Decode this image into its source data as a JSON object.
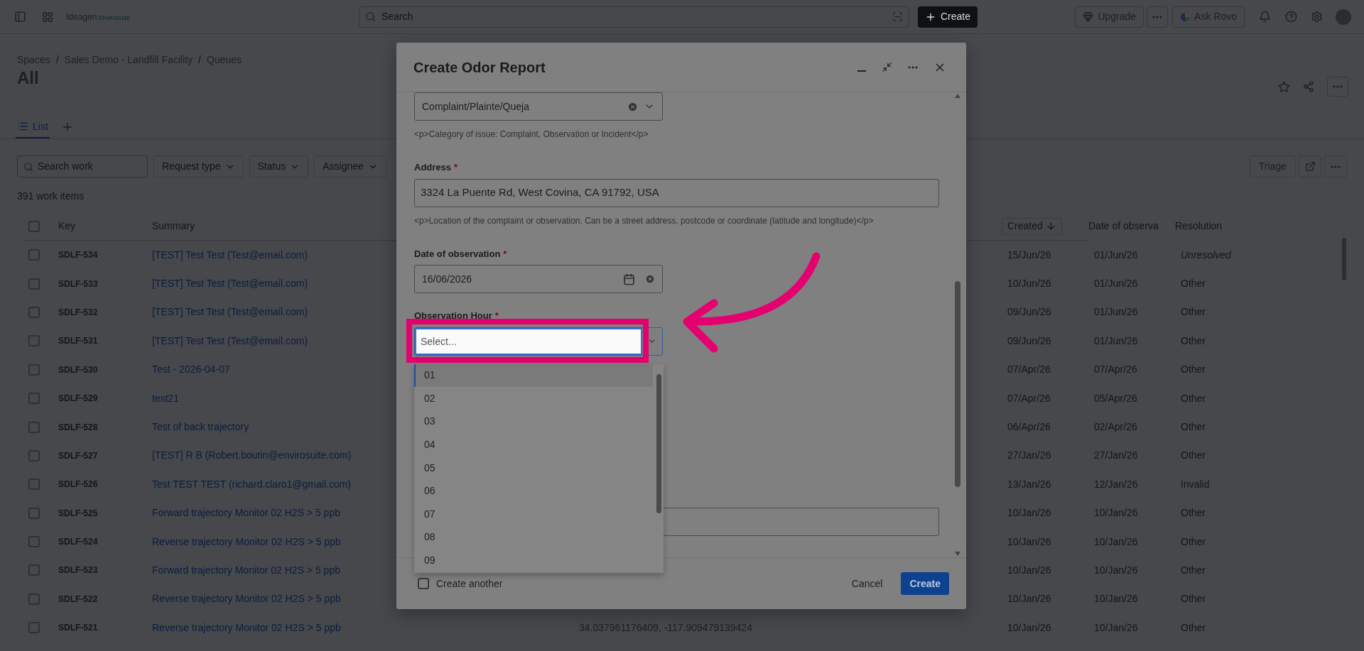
{
  "topbar": {
    "logo": "Ideagen",
    "logo_sub": "Envirosuite",
    "search": {
      "placeholder": "Search"
    },
    "create": "Create",
    "upgrade": "Upgrade",
    "ask": "Ask Rovo"
  },
  "breadcrumbs": [
    "Spaces",
    "Sales Demo - Landfill Facility",
    "Queues"
  ],
  "breadcrumb_separator": "/",
  "title": "All",
  "tabs": [
    {
      "label": "List",
      "selected": true
    }
  ],
  "filters": {
    "search": {
      "placeholder": "Search work"
    },
    "dropdowns": [
      "Request type",
      "Status",
      "Assignee"
    ],
    "triage": "Triage"
  },
  "count": "391 work items",
  "table": {
    "select_all": {
      "checked": false
    },
    "columns": [
      {
        "label": "Key",
        "sorted": false
      },
      {
        "label": "Summary",
        "sorted": false
      },
      {
        "label": "Created",
        "sorted": true
      },
      {
        "label": "Date of observa",
        "sorted": false
      },
      {
        "label": "Resolution",
        "sorted": false
      }
    ],
    "rows": [
      {
        "key": "SDLF-534",
        "summary": "[TEST] Test Test (Test@email.com)",
        "created": "15/Jun/26",
        "date": "01/Jun/26",
        "resolution": "Unresolved",
        "resolved": false,
        "checked": false
      },
      {
        "key": "SDLF-533",
        "summary": "[TEST] Test Test (Test@email.com)",
        "created": "10/Jun/26",
        "date": "01/Jun/26",
        "resolution": "Other",
        "resolved": true,
        "checked": false
      },
      {
        "key": "SDLF-532",
        "summary": "[TEST] Test Test (Test@email.com)",
        "created": "09/Jun/26",
        "date": "01/Jun/26",
        "resolution": "Other",
        "resolved": true,
        "checked": false
      },
      {
        "key": "SDLF-531",
        "summary": "[TEST] Test Test (Test@email.com)",
        "created": "09/Jun/26",
        "date": "01/Jun/26",
        "resolution": "Other",
        "resolved": true,
        "checked": false
      },
      {
        "key": "SDLF-530",
        "summary": "Test - 2026-04-07",
        "created": "07/Apr/26",
        "date": "07/Apr/26",
        "resolution": "Other",
        "resolved": true,
        "checked": false
      },
      {
        "key": "SDLF-529",
        "summary": "test21",
        "created": "07/Apr/26",
        "date": "05/Apr/26",
        "resolution": "Other",
        "resolved": true,
        "checked": false
      },
      {
        "key": "SDLF-528",
        "summary": "Test of back trajectory",
        "created": "06/Apr/26",
        "date": "02/Apr/26",
        "resolution": "Other",
        "resolved": true,
        "checked": false
      },
      {
        "key": "SDLF-527",
        "summary": "[TEST] R B (Robert.boutin@envirosuite.com)",
        "created": "27/Jan/26",
        "date": "27/Jan/26",
        "resolution": "Other",
        "resolved": true,
        "checked": false
      },
      {
        "key": "SDLF-526",
        "summary": "Test TEST TEST (richard.claro1@gmail.com)",
        "created": "13/Jan/26",
        "date": "12/Jan/26",
        "resolution": "Invalid",
        "resolved": true,
        "checked": false
      },
      {
        "key": "SDLF-525",
        "summary": "Forward trajectory Monitor 02 H2S > 5 ppb",
        "created": "10/Jan/26",
        "date": "10/Jan/26",
        "resolution": "Other",
        "resolved": true,
        "checked": false
      },
      {
        "key": "SDLF-524",
        "summary": "Reverse trajectory Monitor 02 H2S > 5 ppb",
        "created": "10/Jan/26",
        "date": "10/Jan/26",
        "resolution": "Other",
        "resolved": true,
        "checked": false
      },
      {
        "key": "SDLF-523",
        "summary": "Forward trajectory Monitor 02 H2S > 5 ppb",
        "created": "10/Jan/26",
        "date": "10/Jan/26",
        "resolution": "Other",
        "resolved": true,
        "checked": false
      },
      {
        "key": "SDLF-522",
        "summary": "Reverse trajectory Monitor 02 H2S > 5 ppb",
        "created": "10/Jan/26",
        "date": "10/Jan/26",
        "resolution": "Other",
        "resolved": true,
        "checked": false
      },
      {
        "key": "SDLF-521",
        "summary": "Reverse trajectory Monitor 02 H2S > 5 ppb",
        "column_4": "34.037961176409, -117.909479139424",
        "created": "10/Jan/26",
        "date": "10/Jan/26",
        "resolution": "Other",
        "resolved": true,
        "checked": false
      }
    ]
  },
  "dialog": {
    "title": "Create Odor Report",
    "required_mark": "*",
    "fields": [
      {
        "kind": "select",
        "value": "Complaint/Plainte/Queja",
        "helper": "<p>Category of issue: Complaint, Observation or Incident</p>"
      },
      {
        "kind": "text",
        "label": "Address",
        "required": true,
        "value": "3324 La Puente Rd, West Covina, CA 91792, USA",
        "helper": "<p>Location of the complaint or observation. Can be a street address, postcode or coordinate (latitude and longitude)</p>"
      },
      {
        "kind": "date",
        "label": "Date of observation",
        "required": true,
        "value": "16/06/2026"
      },
      {
        "kind": "combo",
        "label": "Observation Hour",
        "required": true,
        "placeholder": "Select...",
        "highlighted": true,
        "options": [
          {
            "label": "01",
            "selected": true
          },
          {
            "label": "02",
            "selected": false
          },
          {
            "label": "03",
            "selected": false
          },
          {
            "label": "04",
            "selected": false
          },
          {
            "label": "05",
            "selected": false
          },
          {
            "label": "06",
            "selected": false
          },
          {
            "label": "07",
            "selected": false
          },
          {
            "label": "08",
            "selected": false
          },
          {
            "label": "09",
            "selected": false
          }
        ]
      },
      {
        "kind": "text"
      }
    ],
    "create_another": {
      "label": "Create another",
      "checked": false
    },
    "cancel": "Cancel",
    "submit": "Create"
  }
}
